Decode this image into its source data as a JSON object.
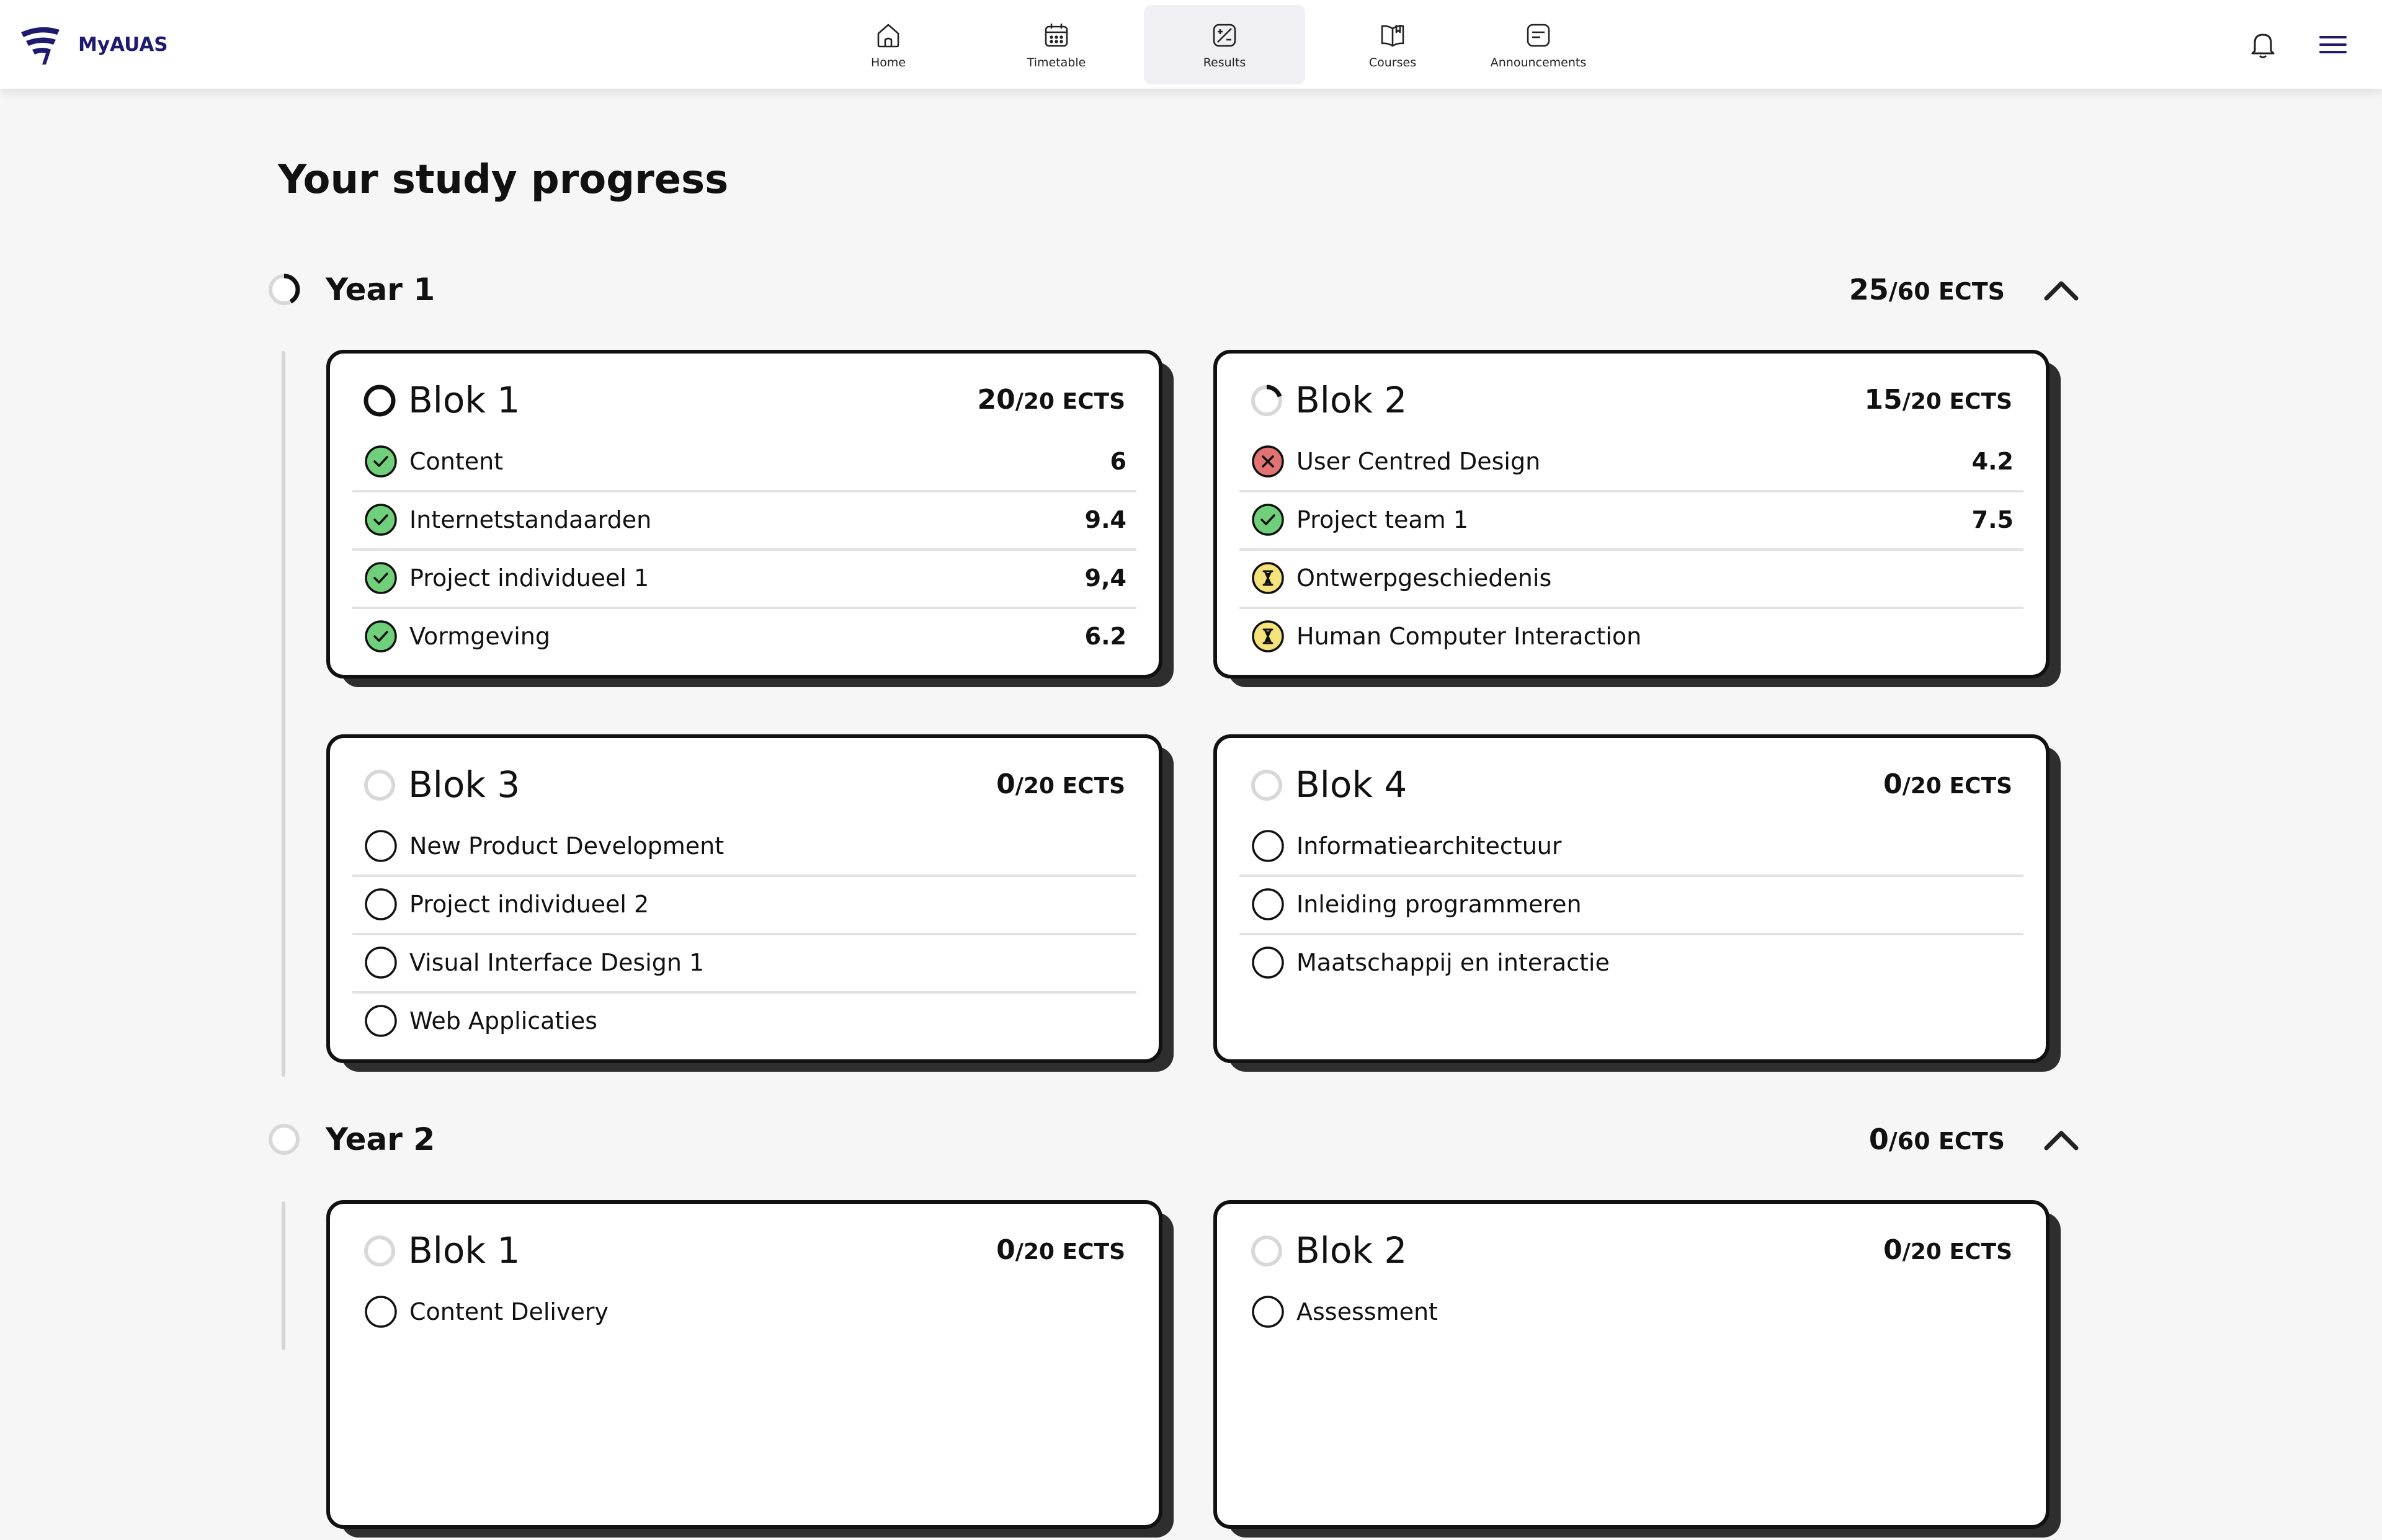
{
  "app": {
    "name": "MyAUAS"
  },
  "nav": [
    {
      "label": "Home",
      "icon": "home-icon"
    },
    {
      "label": "Timetable",
      "icon": "calendar-icon"
    },
    {
      "label": "Results",
      "icon": "results-icon",
      "active": true
    },
    {
      "label": "Courses",
      "icon": "book-icon"
    },
    {
      "label": "Announcements",
      "icon": "announcement-icon"
    }
  ],
  "header_icons": [
    "bell-icon",
    "hamburger-menu-icon"
  ],
  "page": {
    "title": "Your study progress"
  },
  "colors": {
    "brand": "#1e1b6e",
    "passed": "#6fcf7b",
    "failed": "#e37373",
    "pending": "#f5e27a",
    "card_shadow": "#2e2e2e"
  },
  "years": [
    {
      "title": "Year 1",
      "ects_earned": "25",
      "ects_total": "/60 ECTS",
      "progress": 0.42,
      "blocks": [
        {
          "title": "Blok 1",
          "ects_earned": "20",
          "ects_total": "/20 ECTS",
          "progress": 1.0,
          "courses": [
            {
              "name": "Content",
              "grade": "6",
              "status": "passed"
            },
            {
              "name": "Internetstandaarden",
              "grade": "9.4",
              "status": "passed"
            },
            {
              "name": "Project individueel 1",
              "grade": "9,4",
              "status": "passed"
            },
            {
              "name": "Vormgeving",
              "grade": "6.2",
              "status": "passed"
            }
          ]
        },
        {
          "title": "Blok 2",
          "ects_earned": "15",
          "ects_total": "/20 ECTS",
          "progress": 0.2,
          "courses": [
            {
              "name": "User Centred Design",
              "grade": "4.2",
              "status": "failed"
            },
            {
              "name": "Project team 1",
              "grade": "7.5",
              "status": "passed"
            },
            {
              "name": "Ontwerpgeschiedenis",
              "grade": "",
              "status": "pending"
            },
            {
              "name": "Human Computer Interaction",
              "grade": "",
              "status": "pending"
            }
          ]
        },
        {
          "title": "Blok 3",
          "ects_earned": "0",
          "ects_total": "/20 ECTS",
          "progress": 0,
          "courses": [
            {
              "name": "New Product Development",
              "grade": "",
              "status": "not-started"
            },
            {
              "name": "Project individueel 2",
              "grade": "",
              "status": "not-started"
            },
            {
              "name": "Visual Interface Design 1",
              "grade": "",
              "status": "not-started"
            },
            {
              "name": "Web Applicaties",
              "grade": "",
              "status": "not-started"
            }
          ]
        },
        {
          "title": "Blok 4",
          "ects_earned": "0",
          "ects_total": "/20 ECTS",
          "progress": 0,
          "courses": [
            {
              "name": "Informatiearchitectuur",
              "grade": "",
              "status": "not-started"
            },
            {
              "name": "Inleiding programmeren",
              "grade": "",
              "status": "not-started"
            },
            {
              "name": "Maatschappij en interactie",
              "grade": "",
              "status": "not-started"
            }
          ]
        }
      ]
    },
    {
      "title": "Year 2",
      "ects_earned": "0",
      "ects_total": "/60 ECTS",
      "progress": 0,
      "blocks": [
        {
          "title": "Blok 1",
          "ects_earned": "0",
          "ects_total": "/20 ECTS",
          "progress": 0,
          "courses": [
            {
              "name": "Content Delivery",
              "grade": "",
              "status": "not-started"
            }
          ]
        },
        {
          "title": "Blok 2",
          "ects_earned": "0",
          "ects_total": "/20 ECTS",
          "progress": 0,
          "courses": [
            {
              "name": "Assessment",
              "grade": "",
              "status": "not-started"
            }
          ]
        }
      ]
    }
  ]
}
